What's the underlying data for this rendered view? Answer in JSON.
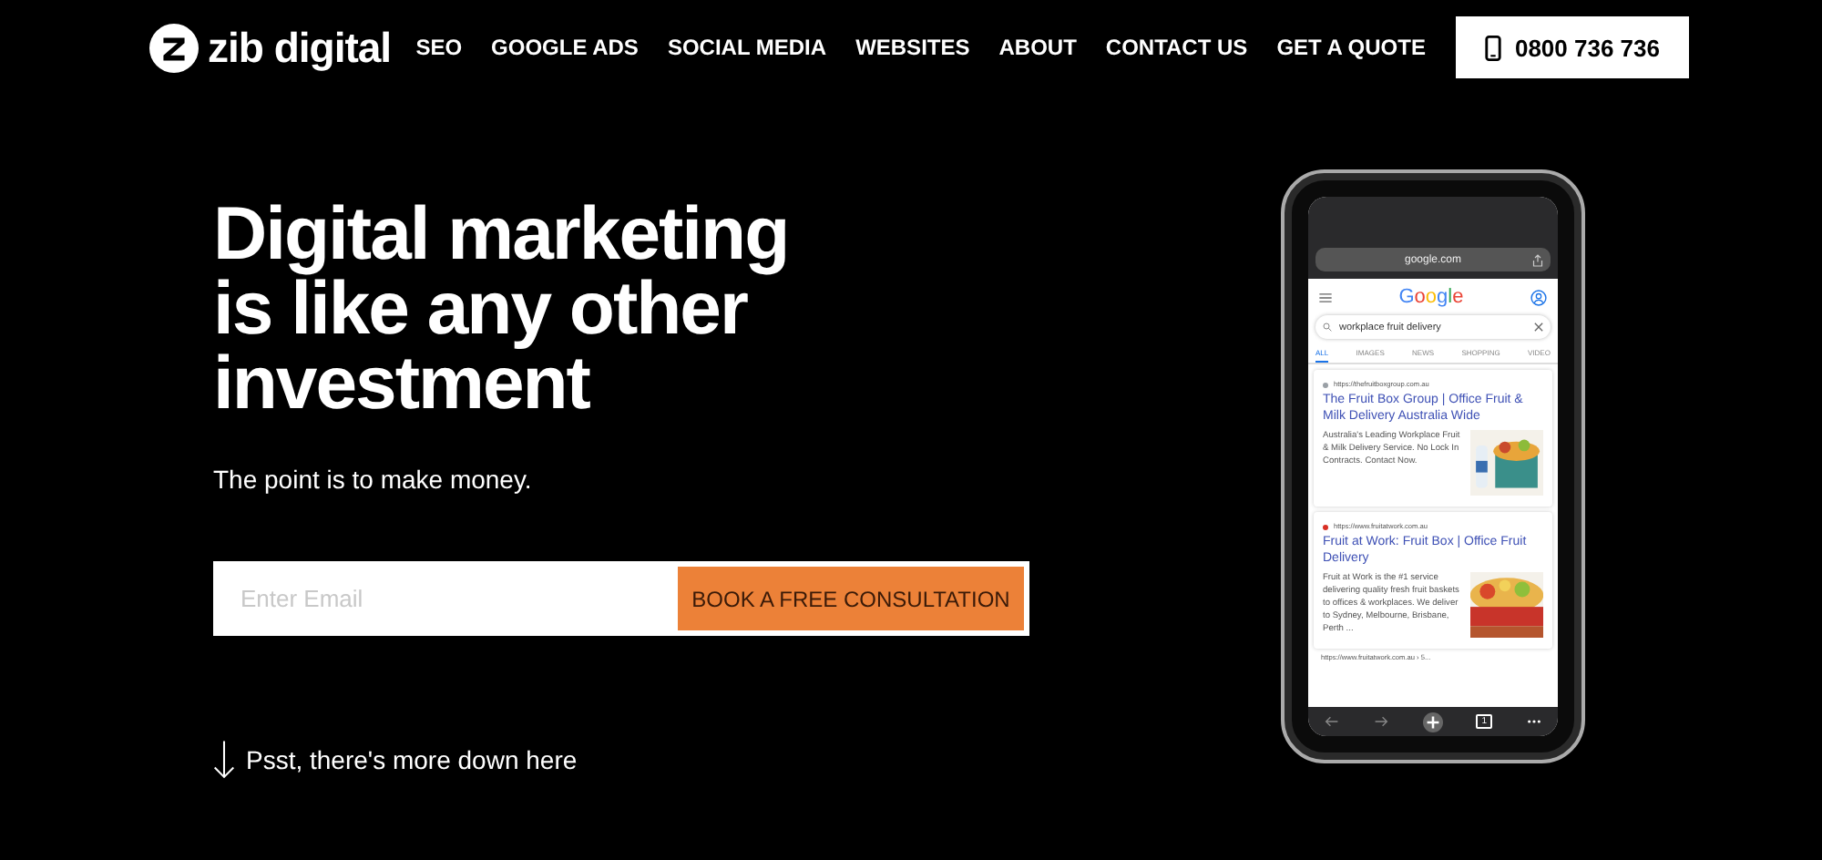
{
  "brand": {
    "name": "zib digital"
  },
  "nav": [
    {
      "label": "SEO"
    },
    {
      "label": "GOOGLE ADS"
    },
    {
      "label": "SOCIAL MEDIA"
    },
    {
      "label": "WEBSITES"
    },
    {
      "label": "ABOUT"
    },
    {
      "label": "CONTACT US"
    },
    {
      "label": "GET A QUOTE"
    }
  ],
  "phone_button": {
    "label": "0800 736 736"
  },
  "hero": {
    "heading": [
      "Digital marketing",
      "is like any other",
      "investment"
    ],
    "subtitle": "The point is to make money.",
    "email_field": {
      "placeholder": "Enter Email"
    },
    "cta": "BOOK A FREE CONSULTATION",
    "scroll_hint": "Psst, there's more down here"
  },
  "phone": {
    "address": "google.com",
    "logo": "Google",
    "query": "workplace fruit delivery",
    "tabs": [
      {
        "label": "ALL",
        "selected": true
      },
      {
        "label": "IMAGES",
        "selected": false
      },
      {
        "label": "NEWS",
        "selected": false
      },
      {
        "label": "SHOPPING",
        "selected": false
      },
      {
        "label": "VIDEO",
        "selected": false
      }
    ],
    "results": [
      {
        "url": "https://thefruitboxgroup.com.au",
        "color": "#9aa0a6",
        "title": "The Fruit Box Group | Office Fruit & Milk Delivery Australia Wide",
        "snippet": "Australia's Leading Workplace Fruit & Milk Delivery Service. No Lock In Contracts. Contact Now."
      },
      {
        "url": "https://www.fruitatwork.com.au",
        "color": "#d93025",
        "title": "Fruit at Work: Fruit Box | Office Fruit Delivery",
        "snippet": "Fruit at Work is the #1 service delivering quality fresh fruit baskets to offices & workplaces. We deliver to Sydney, Melbourne, Brisbane, Perth ..."
      }
    ],
    "more_url": "https://www.fruitatwork.com.au › 5...",
    "tab_count": "1"
  }
}
